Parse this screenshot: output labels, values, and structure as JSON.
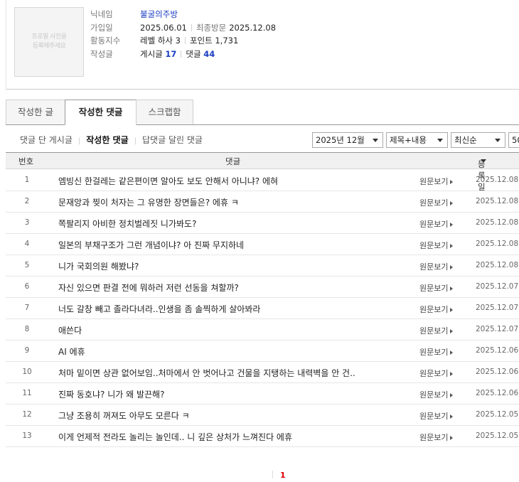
{
  "profile": {
    "photo_placeholder": "프로필 사진을\n등록해주세요",
    "labels": {
      "nickname": "닉네임",
      "joined": "가입일",
      "activity": "활동지수",
      "posts": "작성글"
    },
    "nickname": "불굴의주방",
    "joined": "2025.06.01",
    "last_visit_label": "최종방문",
    "last_visit": "2025.12.08",
    "level": "레벨 하사 3",
    "points": "포인트 1,731",
    "posts_label": "게시글",
    "posts_count": "17",
    "comments_label": "댓글",
    "comments_count": "44"
  },
  "tabs": [
    "작성한 글",
    "작성한 댓글",
    "스크랩함"
  ],
  "subnav": [
    "댓글 단 게시글",
    "작성한 댓글",
    "답댓글 달린 댓글"
  ],
  "filters": {
    "month": "2025년 12월",
    "search_type": "제목+내용",
    "sort": "최신순",
    "per_page": "50"
  },
  "table": {
    "headers": {
      "no": "번호",
      "comment": "댓글",
      "date": "등록일"
    },
    "view_label": "원문보기",
    "rows": [
      {
        "no": "1",
        "comment": "엠빙신 한걸레는 같은편이면 알아도 보도 안해서 아니냐? 에혀",
        "date": "2025.12.08"
      },
      {
        "no": "2",
        "comment": "문재앙과 찢이 처자는 그 유명한 장면들은? 에휴 ㅋ",
        "date": "2025.12.08"
      },
      {
        "no": "3",
        "comment": "쪽팔리지 아비한 정치벌레짓 니가봐도?",
        "date": "2025.12.08"
      },
      {
        "no": "4",
        "comment": "일본의 부채구조가 그런 개념이냐? 아 진짜 무지하네",
        "date": "2025.12.08"
      },
      {
        "no": "5",
        "comment": "니가 국회의원 해봤냐?",
        "date": "2025.12.08"
      },
      {
        "no": "6",
        "comment": "자신 있으면 판결 전에 뭐하러 저런 선동을 쳐할까?",
        "date": "2025.12.07"
      },
      {
        "no": "7",
        "comment": "너도 갈창 빼고 졸라다녀라..인생을 좀 솔찍하게 살아봐라",
        "date": "2025.12.07"
      },
      {
        "no": "8",
        "comment": "애쓴다",
        "date": "2025.12.07"
      },
      {
        "no": "9",
        "comment": "AI 에휴",
        "date": "2025.12.06"
      },
      {
        "no": "10",
        "comment": "처마 밑이면 상관 없어보임..처마에서 안 벗어나고 건물을 지탱하는 내력벽을 안 건..",
        "date": "2025.12.06"
      },
      {
        "no": "11",
        "comment": "진짜 동호냐? 니가 왜 발끈해?",
        "date": "2025.12.06"
      },
      {
        "no": "12",
        "comment": "그냥 조용히 꺼져도 아무도 모른다 ㅋ",
        "date": "2025.12.05"
      },
      {
        "no": "13",
        "comment": "이게 언제적 전라도 놀리는 놀인데.. 니 깊은 상처가 느껴진다 에휴",
        "date": "2025.12.05"
      }
    ]
  },
  "pagination": {
    "current": "1"
  }
}
